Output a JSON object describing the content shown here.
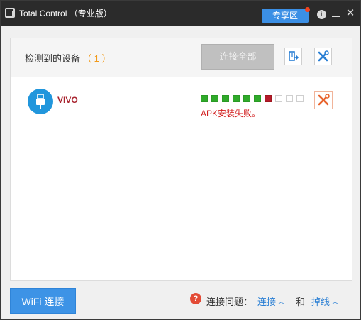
{
  "titlebar": {
    "title": "Total Control （专业版）",
    "zone_button": "专享区"
  },
  "panel": {
    "detected_label": "检测到的设备",
    "detected_count": "（ 1 ）",
    "connect_all_label": "连接全部"
  },
  "device": {
    "name": "VIVO",
    "progress_segments": 10,
    "completed_segments": 6,
    "failed_segment_index": 6,
    "status": "APK安装失败。"
  },
  "bottom": {
    "wifi_button": "WiFi 连接",
    "problem_label": "连接问题：",
    "connect_link": "连接",
    "and_label": "和",
    "disconnect_link": "掉线"
  },
  "colors": {
    "accent": "#3d93e6",
    "ok": "#2faa2a",
    "fail": "#b41a2a",
    "error_text": "#d21e1e"
  }
}
